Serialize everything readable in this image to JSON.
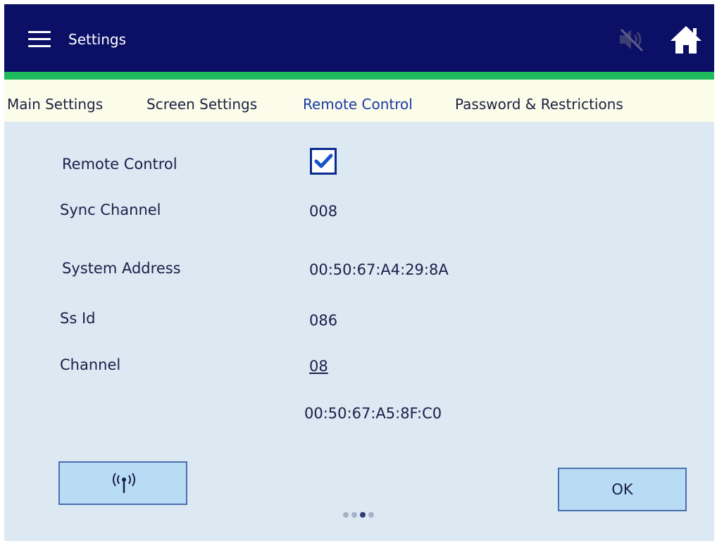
{
  "header": {
    "title": "Settings",
    "menu_icon": "hamburger-menu-icon",
    "mute_icon": "speaker-muted-icon",
    "home_icon": "home-icon"
  },
  "tabs": [
    {
      "label": "Main Settings",
      "active": false
    },
    {
      "label": "Screen Settings",
      "active": false
    },
    {
      "label": "Remote Control",
      "active": true
    },
    {
      "label": "Password & Restrictions",
      "active": false
    }
  ],
  "form": {
    "remote_control_label": "Remote Control",
    "remote_control_checked": true,
    "sync_channel_label": "Sync Channel",
    "sync_channel_value": "008",
    "system_address_label": "System Address",
    "system_address_value": "00:50:67:A4:29:8A",
    "ss_id_label": "Ss Id",
    "ss_id_value": "086",
    "channel_label": "Channel",
    "channel_value": "08",
    "device_address_value": "00:50:67:A5:8F:C0"
  },
  "buttons": {
    "remote_icon": "antenna-signal-icon",
    "ok_label": "OK"
  },
  "pagination": {
    "total": 4,
    "current": 3
  },
  "colors": {
    "header_bg": "#0b0f66",
    "accent_green": "#1fba5c",
    "tab_bg": "#fbfcea",
    "active_tab": "#1a3aa8",
    "content_bg": "#dce8f2",
    "button_bg": "#b9dcf5"
  }
}
